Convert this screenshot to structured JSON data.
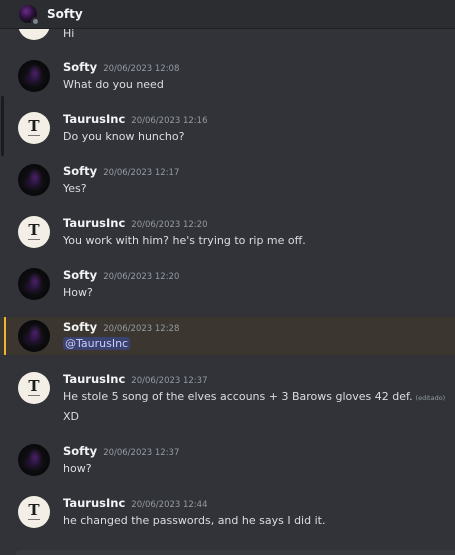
{
  "header": {
    "channel_name": "Softy"
  },
  "partial_message": {
    "text": "Hi"
  },
  "messages": [
    {
      "author": "Softy",
      "avatar": "softy-avatar",
      "timestamp": "20/06/2023 12:08",
      "lines": [
        "What do you need"
      ]
    },
    {
      "author": "TaurusInc",
      "avatar": "taurus-avatar",
      "timestamp": "20/06/2023 12:16",
      "lines": [
        "Do you know huncho?"
      ]
    },
    {
      "author": "Softy",
      "avatar": "softy-avatar",
      "timestamp": "20/06/2023 12:17",
      "lines": [
        "Yes?"
      ]
    },
    {
      "author": "TaurusInc",
      "avatar": "taurus-avatar",
      "timestamp": "20/06/2023 12:20",
      "lines": [
        "You work with him? he's trying to rip me off."
      ]
    },
    {
      "author": "Softy",
      "avatar": "softy-avatar",
      "timestamp": "20/06/2023 12:20",
      "lines": [
        "How?"
      ]
    },
    {
      "author": "Softy",
      "avatar": "softy-avatar",
      "timestamp": "20/06/2023 12:28",
      "mention": "@TaurusInc",
      "highlighted": true
    },
    {
      "author": "TaurusInc",
      "avatar": "taurus-avatar",
      "timestamp": "20/06/2023 12:37",
      "lines": [
        "He stole 5 song of the elves accouns + 3 Barows gloves 42 def.",
        "XD"
      ],
      "edited_label": "(editado)"
    },
    {
      "author": "Softy",
      "avatar": "softy-avatar",
      "timestamp": "20/06/2023 12:37",
      "lines": [
        "how?"
      ]
    },
    {
      "author": "TaurusInc",
      "avatar": "taurus-avatar",
      "timestamp": "20/06/2023 12:44",
      "lines": [
        "he changed the passwords, and he says I did it."
      ]
    }
  ],
  "colors": {
    "background": "#313338",
    "header": "#2b2d31",
    "highlight": "#3b3730",
    "highlight_bar": "#f0b232",
    "mention_bg": "#3c4270"
  }
}
